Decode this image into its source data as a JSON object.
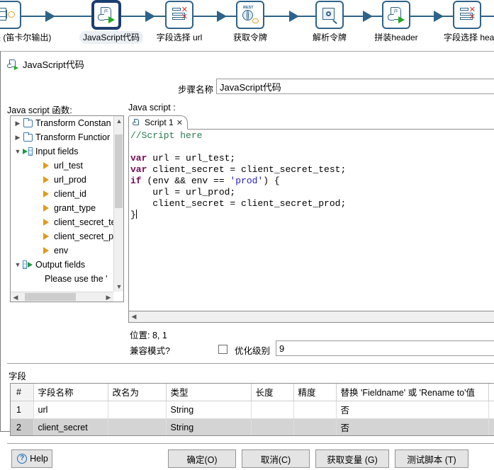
{
  "pipeline": {
    "steps": [
      {
        "label": "关联 (笛卡尔输出)",
        "icon": "join-cartesian-icon",
        "selected": false
      },
      {
        "label": "JavaScript代码",
        "icon": "javascript-code-icon",
        "selected": true
      },
      {
        "label": "字段选择 url",
        "icon": "select-values-icon",
        "selected": false
      },
      {
        "label": "获取令牌",
        "icon": "rest-client-icon",
        "selected": false
      },
      {
        "label": "解析令牌",
        "icon": "json-input-icon",
        "selected": false
      },
      {
        "label": "拼装header",
        "icon": "javascript-code-icon",
        "selected": false
      },
      {
        "label": "字段选择 header",
        "icon": "select-values-icon",
        "selected": false
      }
    ]
  },
  "dialog": {
    "title": "JavaScript代码",
    "title_icon": "javascript-code-icon",
    "step_name_label": "步骤名称",
    "step_name_value": "JavaScript代码",
    "js_functions_label": "Java script 函数:",
    "js_script_label": "Java script :",
    "tree": {
      "nodes": [
        {
          "label": "Transform Constan",
          "icon": "folder-icon",
          "twist": "collapsed",
          "indent": 0
        },
        {
          "label": "Transform Functior",
          "icon": "folder-icon",
          "twist": "collapsed",
          "indent": 0
        },
        {
          "label": "Input fields",
          "icon": "input-fields-icon",
          "twist": "expanded",
          "indent": 0
        },
        {
          "label": "url_test",
          "icon": "field-icon",
          "twist": "",
          "indent": 2
        },
        {
          "label": "url_prod",
          "icon": "field-icon",
          "twist": "",
          "indent": 2
        },
        {
          "label": "client_id",
          "icon": "field-icon",
          "twist": "",
          "indent": 2
        },
        {
          "label": "grant_type",
          "icon": "field-icon",
          "twist": "",
          "indent": 2
        },
        {
          "label": "client_secret_tes",
          "icon": "field-icon",
          "twist": "",
          "indent": 2
        },
        {
          "label": "client_secret_pro",
          "icon": "field-icon",
          "twist": "",
          "indent": 2
        },
        {
          "label": "env",
          "icon": "field-icon",
          "twist": "",
          "indent": 2
        },
        {
          "label": "Output fields",
          "icon": "output-fields-icon",
          "twist": "expanded",
          "indent": 0
        },
        {
          "label": "Please use the '",
          "icon": "",
          "twist": "",
          "indent": 2
        }
      ]
    },
    "editor": {
      "tab_label": "Script 1",
      "tab_close_glyph": "✕",
      "code_lines": [
        {
          "text": "//Script here",
          "type": "comment"
        },
        {
          "text": "",
          "type": "blank"
        },
        {
          "text": "var url = url_test;",
          "type": "code"
        },
        {
          "text": "var client_secret = client_secret_test;",
          "type": "code"
        },
        {
          "text": "if (env && env == 'prod') {",
          "type": "code"
        },
        {
          "text": "    url = url_prod;",
          "type": "code"
        },
        {
          "text": "    client_secret = client_secret_prod;",
          "type": "code"
        },
        {
          "text": "}",
          "type": "code"
        }
      ]
    },
    "position_label": "位置: 8, 1",
    "compat_mode_label": "兼容模式?",
    "compat_mode_checked": false,
    "optimization_label": "优化级别",
    "optimization_value": "9",
    "fields_caption": "字段",
    "fields_table": {
      "headers": [
        "#",
        "字段名称",
        "改名为",
        "类型",
        "长度",
        "精度",
        "替换 'Fieldname' 或 'Rename to'值",
        ""
      ],
      "rows": [
        {
          "cells": [
            "1",
            "url",
            "",
            "String",
            "",
            "",
            "否",
            ""
          ],
          "selected": false
        },
        {
          "cells": [
            "2",
            "client_secret",
            "",
            "String",
            "",
            "",
            "否",
            ""
          ],
          "selected": true
        }
      ]
    },
    "buttons": {
      "help": "Help",
      "ok": "确定(O)",
      "cancel": "取消(C)",
      "get_variables": "获取变量 (G)",
      "test_script": "测试脚本 (T)"
    }
  },
  "colors": {
    "hop_blue": "#2e6389",
    "selection_blue": "#1b3e70",
    "selected_label_bg": "#e9eff3",
    "keyword": "#7a0a52",
    "string": "#2222cc",
    "comment": "#2a7a4f",
    "row_selected": "#d4d4d4"
  }
}
